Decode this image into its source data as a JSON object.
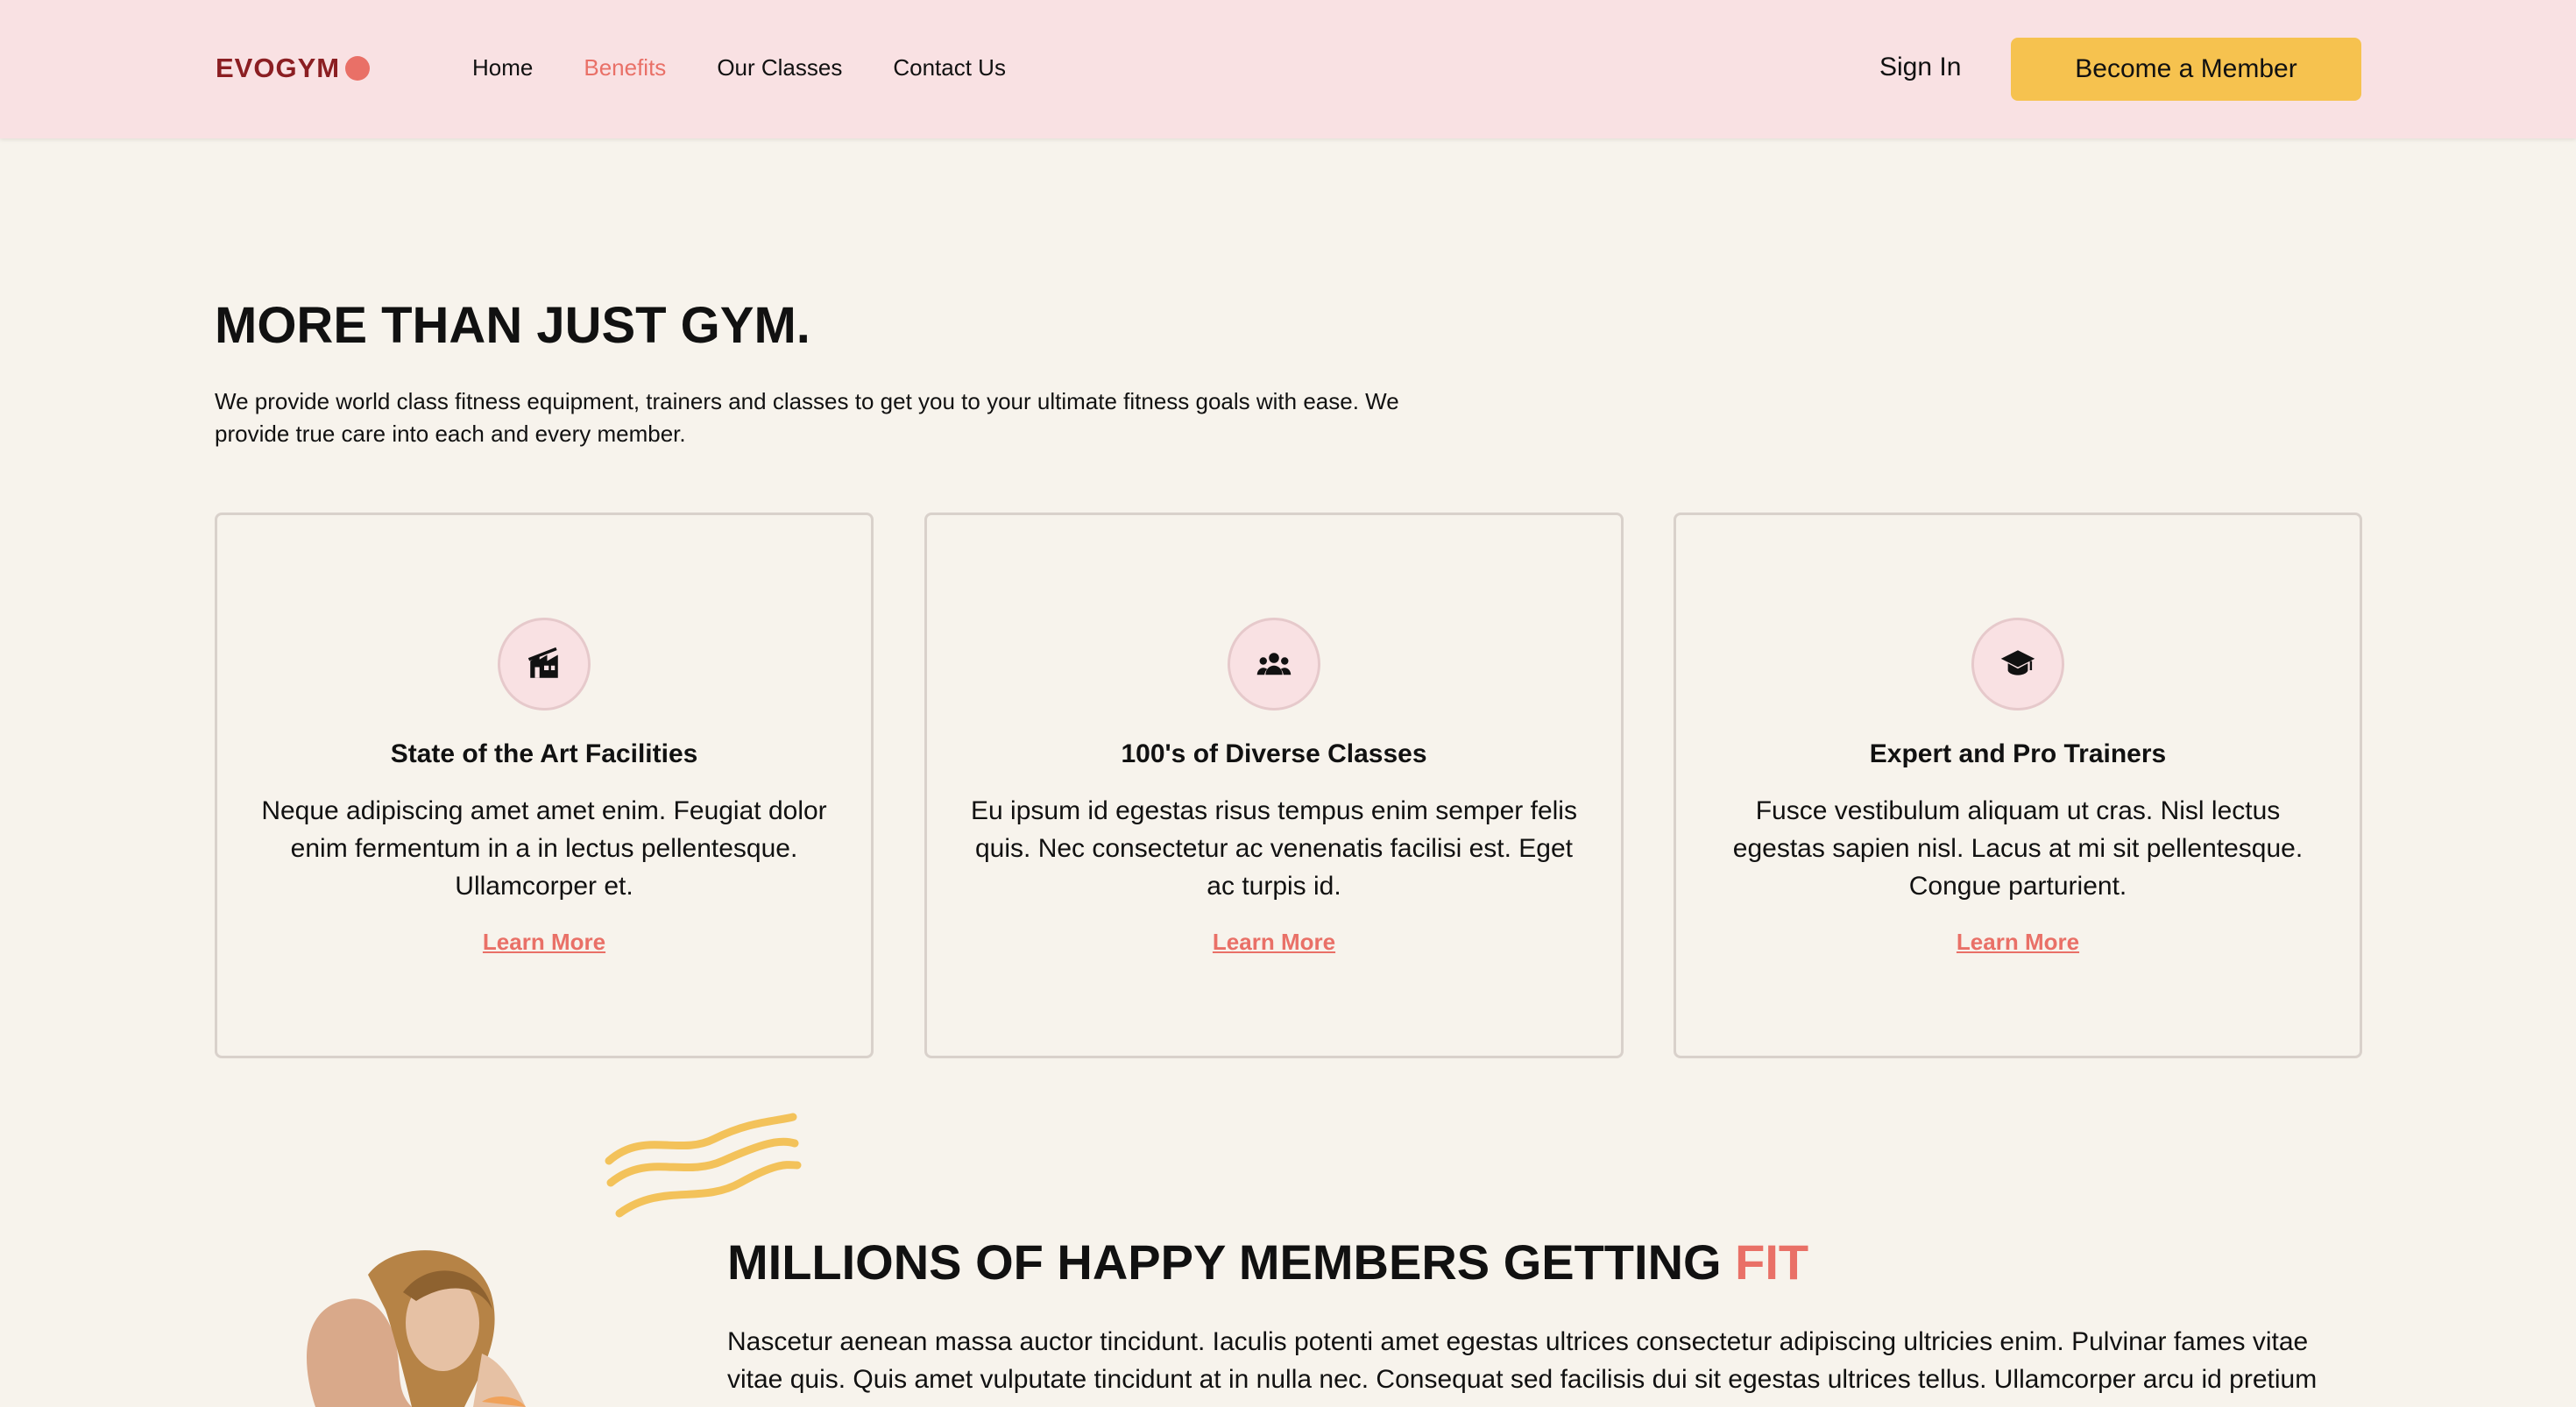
{
  "navbar": {
    "logo_text": "EVOGYM",
    "links": [
      {
        "label": "Home",
        "active": false
      },
      {
        "label": "Benefits",
        "active": true
      },
      {
        "label": "Our Classes",
        "active": false
      },
      {
        "label": "Contact Us",
        "active": false
      }
    ],
    "sign_in": "Sign In",
    "cta": "Become a Member"
  },
  "benefits": {
    "title": "MORE THAN JUST GYM.",
    "intro": "We provide world class fitness equipment, trainers and classes to get you to your ultimate fitness goals with ease. We provide true care into each and every member.",
    "cards": [
      {
        "icon": "home-modern-icon",
        "title": "State of the Art Facilities",
        "text": "Neque adipiscing amet amet enim. Feugiat dolor enim fermentum in a in lectus pellentesque. Ullamcorper et.",
        "link": "Learn More"
      },
      {
        "icon": "user-group-icon",
        "title": "100's of Diverse Classes",
        "text": "Eu ipsum id egestas risus tempus enim semper felis quis. Nec consectetur ac venenatis facilisi est. Eget ac turpis id.",
        "link": "Learn More"
      },
      {
        "icon": "academic-cap-icon",
        "title": "Expert and Pro Trainers",
        "text": "Fusce vestibulum aliquam ut cras. Nisl lectus egestas sapien nisl. Lacus at mi sit pellentesque. Congue parturient.",
        "link": "Learn More"
      }
    ]
  },
  "members": {
    "title_prefix": "MILLIONS OF HAPPY MEMBERS GETTING",
    "title_highlight": "FIT",
    "text": "Nascetur aenean massa auctor tincidunt. Iaculis potenti amet egestas ultrices consectetur adipiscing ultricies enim. Pulvinar fames vitae vitae quis. Quis amet vulputate tincidunt at in nulla nec. Consequat sed facilisis dui sit egestas ultrices tellus. Ullamcorper arcu id pretium"
  },
  "colors": {
    "nav_bg": "#f9e1e3",
    "page_bg": "#f7f3ec",
    "accent": "#e97067",
    "cta": "#f6c24f",
    "logo": "#8b1e22"
  }
}
